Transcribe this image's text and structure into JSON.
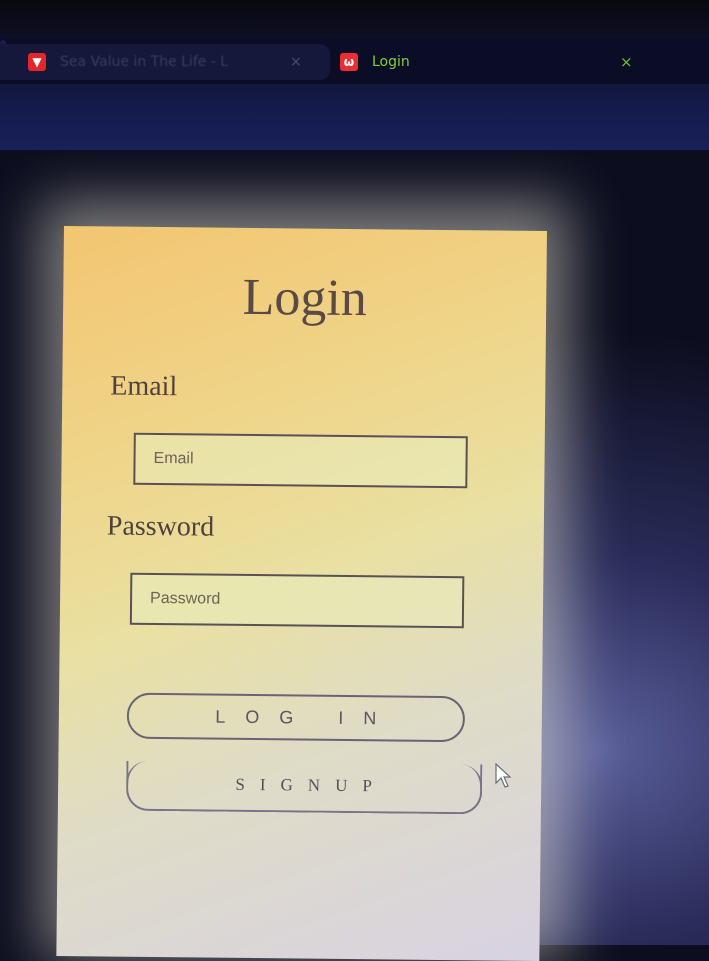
{
  "browser": {
    "tabs": [
      {
        "title": "Sea Value in The Life - L",
        "favicon": "bookmark-icon"
      },
      {
        "title": "Login",
        "favicon": "app-icon"
      }
    ],
    "tab1_close": "×",
    "tab2_close": "×"
  },
  "login": {
    "title": "Login",
    "email_label": "Email",
    "email_placeholder": "Email",
    "password_label": "Password",
    "password_placeholder": "Password",
    "login_button": "LOG IN",
    "signup_button": "SIGNUP"
  },
  "colors": {
    "tab_active_text": "#7fd23a",
    "favicon": "#e4262b",
    "card_top": "#f3c571",
    "card_bottom": "#d8d2e2"
  }
}
